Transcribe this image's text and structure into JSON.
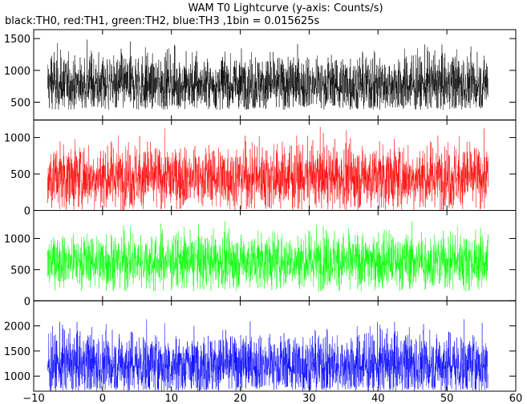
{
  "chart_data": {
    "type": "line",
    "title": "WAM T0 Lightcurve (y-axis: Counts/s)",
    "subtitle": "black:TH0, red:TH1, green:TH2, blue:TH3 ,1bin = 0.015625s",
    "xlabel": "",
    "ylabel": "",
    "xlim": [
      -10,
      60
    ],
    "x_ticks": [
      -10,
      0,
      10,
      20,
      30,
      40,
      50,
      60
    ],
    "x_tick_labels": [
      "−10",
      "0",
      "10",
      "20",
      "30",
      "40",
      "50",
      "60"
    ],
    "x_range": [
      -8,
      56
    ],
    "bin_seconds": 0.015625,
    "grid": false,
    "panels": [
      {
        "name": "TH0",
        "color": "#000000",
        "ylim": [
          220,
          1640
        ],
        "yticks": [
          500,
          1000,
          1500
        ],
        "mean": 780,
        "envelope": [
          380,
          1600
        ]
      },
      {
        "name": "TH1",
        "color": "#ff0000",
        "ylim": [
          0,
          1240
        ],
        "yticks": [
          0,
          500,
          1000
        ],
        "mean": 460,
        "envelope": [
          0,
          1150
        ]
      },
      {
        "name": "TH2",
        "color": "#00ff00",
        "ylim": [
          0,
          1450
        ],
        "yticks": [
          0,
          500,
          1000
        ],
        "mean": 640,
        "envelope": [
          150,
          1300
        ]
      },
      {
        "name": "TH3",
        "color": "#0000ff",
        "ylim": [
          700,
          2500
        ],
        "yticks": [
          1000,
          1500,
          2000
        ],
        "mean": 1230,
        "envelope": [
          700,
          2350
        ]
      }
    ]
  }
}
